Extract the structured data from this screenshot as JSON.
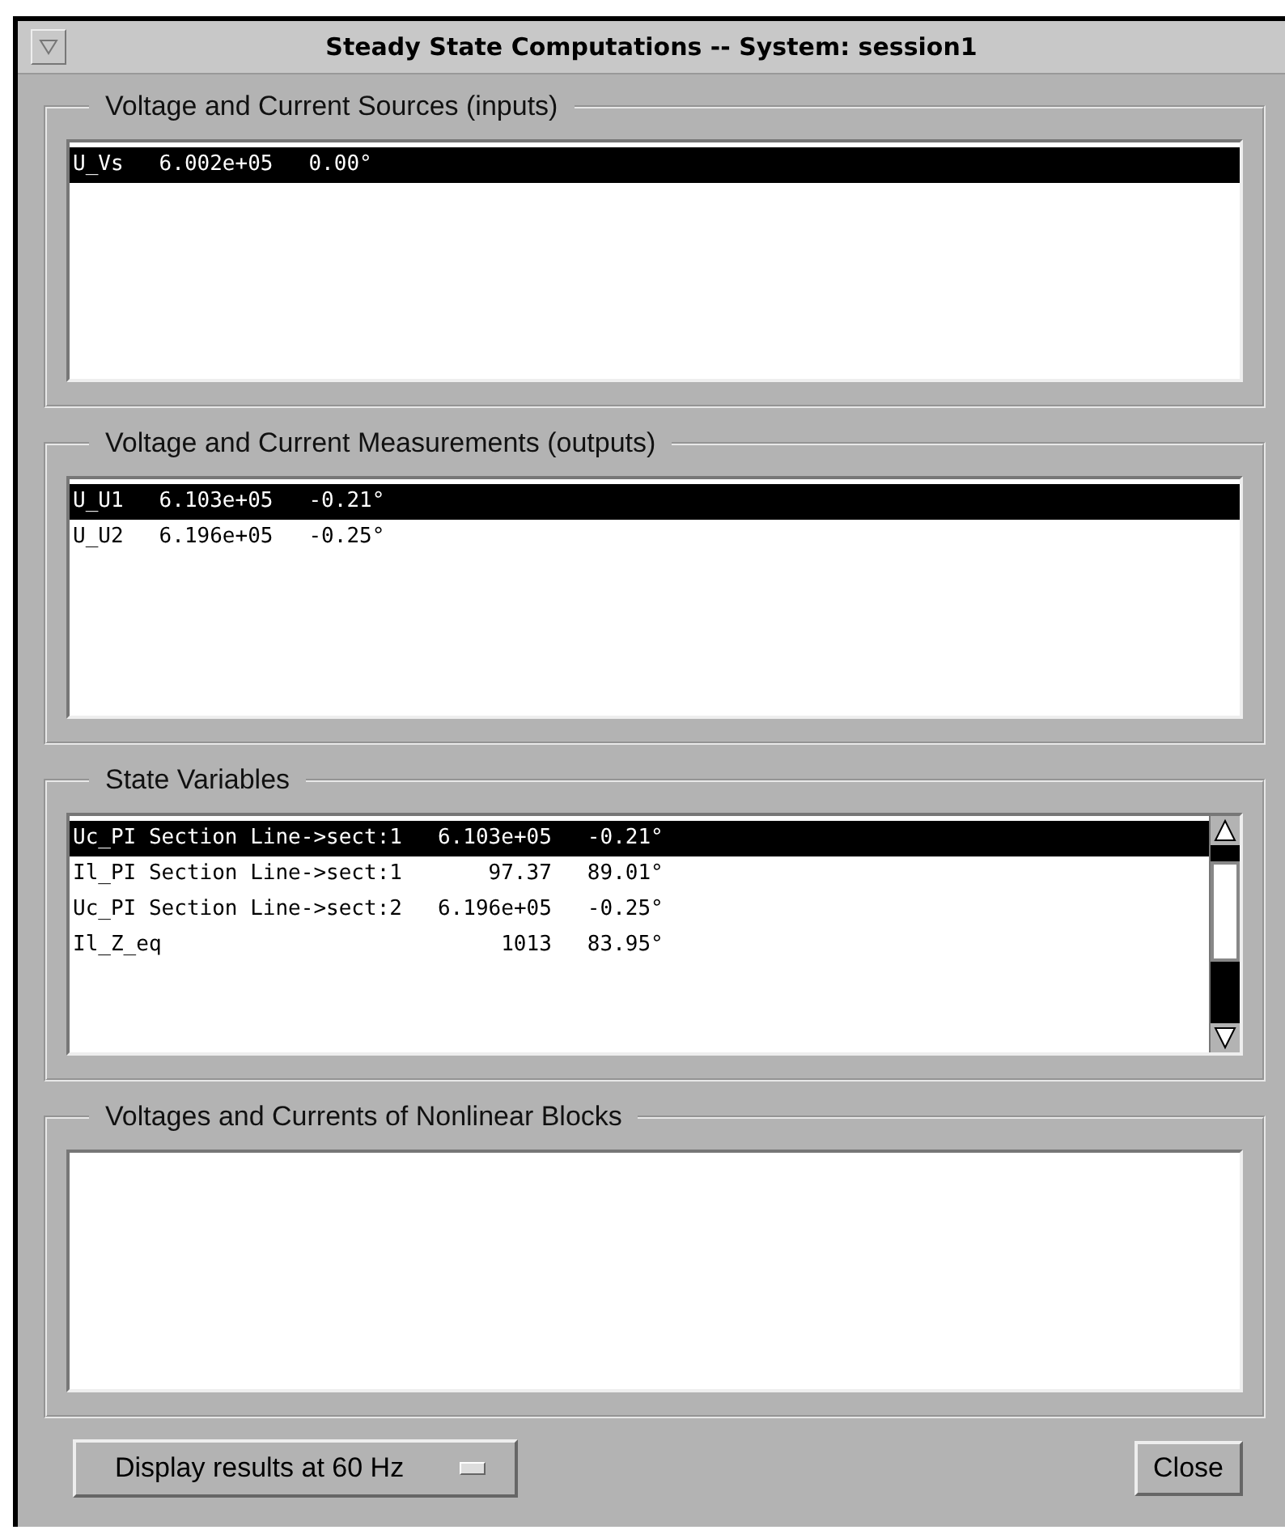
{
  "window": {
    "title": "Steady State Computations -- System: session1"
  },
  "sections": [
    {
      "title": "Voltage and Current Sources (inputs)",
      "scrollbar": false,
      "rows": [
        {
          "cells": [
            "U_Vs",
            "6.002e+05",
            "0.00°"
          ],
          "selected": true
        }
      ]
    },
    {
      "title": "Voltage and Current Measurements (outputs)",
      "scrollbar": false,
      "rows": [
        {
          "cells": [
            "U_U1",
            "6.103e+05",
            "-0.21°"
          ],
          "selected": true
        },
        {
          "cells": [
            "U_U2",
            "6.196e+05",
            "-0.25°"
          ],
          "selected": false
        }
      ]
    },
    {
      "title": "State Variables",
      "scrollbar": true,
      "rows": [
        {
          "cells": [
            "Uc_PI Section Line->sect:1",
            "6.103e+05",
            "-0.21°"
          ],
          "selected": true
        },
        {
          "cells": [
            "Il_PI Section Line->sect:1",
            "97.37",
            "89.01°"
          ],
          "selected": false
        },
        {
          "cells": [
            "Uc_PI Section Line->sect:2",
            "6.196e+05",
            "-0.25°"
          ],
          "selected": false
        },
        {
          "cells": [
            "Il_Z_eq",
            "1013",
            "83.95°"
          ],
          "selected": false
        }
      ]
    },
    {
      "title": "Voltages and Currents of Nonlinear Blocks",
      "scrollbar": false
    }
  ],
  "footer": {
    "dropdown": "Display results at 60 Hz",
    "close_button": "Close"
  }
}
